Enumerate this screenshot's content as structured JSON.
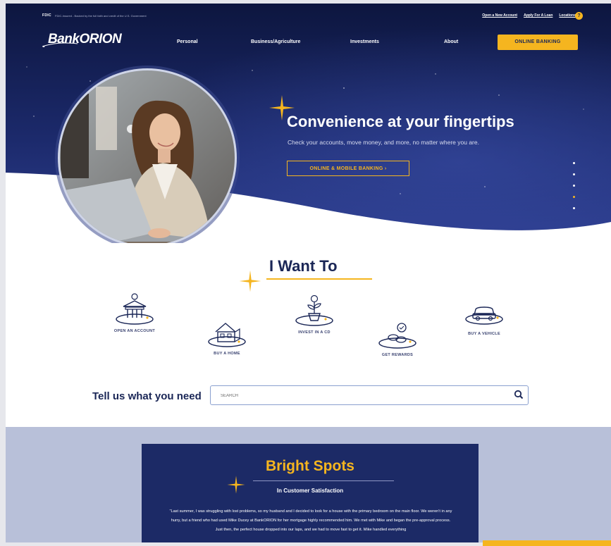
{
  "utility": {
    "fdic": "FDIC",
    "fdic_note": "FDIC-Insured - Backed by the full faith and credit of the U.S. Government",
    "links": [
      "Open a New Account",
      "Apply For A Loan",
      "Locations"
    ],
    "help": "?"
  },
  "brand": {
    "logo": "BankORION"
  },
  "nav": {
    "items": [
      "Personal",
      "Business/Agriculture",
      "Investments",
      "About"
    ],
    "online_banking": "ONLINE BANKING"
  },
  "hero": {
    "title": "Convenience at your fingertips",
    "subtitle": "Check your accounts, move money, and more, no matter where you are.",
    "cta": "ONLINE & MOBILE BANKING  ›",
    "slides_total": 5,
    "slide_active": 4
  },
  "iwant": {
    "title": "I Want To",
    "actions": [
      {
        "label": "OPEN AN ACCOUNT",
        "icon": "bank-building-icon"
      },
      {
        "label": "BUY A HOME",
        "icon": "house-icon"
      },
      {
        "label": "INVEST IN A CD",
        "icon": "money-plant-icon"
      },
      {
        "label": "GET REWARDS",
        "icon": "rewards-coins-icon"
      },
      {
        "label": "BUY A VEHICLE",
        "icon": "car-icon"
      }
    ]
  },
  "search": {
    "label": "Tell us what you need",
    "placeholder": "SEARCH"
  },
  "bright_spots": {
    "title": "Bright Spots",
    "subtitle": "In Customer Satisfaction",
    "quote": "“Last summer, I was struggling with lost problems, so my husband and I decided to look for a house with the primary bedroom on the main floor. We weren't in any hurry, but a friend who had used Mike Ducey at BankORION for her mortgage highly recommended him. We met with Mike and began the pre-approval process. Just then, the perfect house dropped into our laps, and we had to move fast to get it. Mike handled everything"
  },
  "colors": {
    "navy": "#1a2656",
    "gold": "#f5b51f",
    "card": "#1c2a66",
    "lower_bg": "#b8c0d9"
  }
}
